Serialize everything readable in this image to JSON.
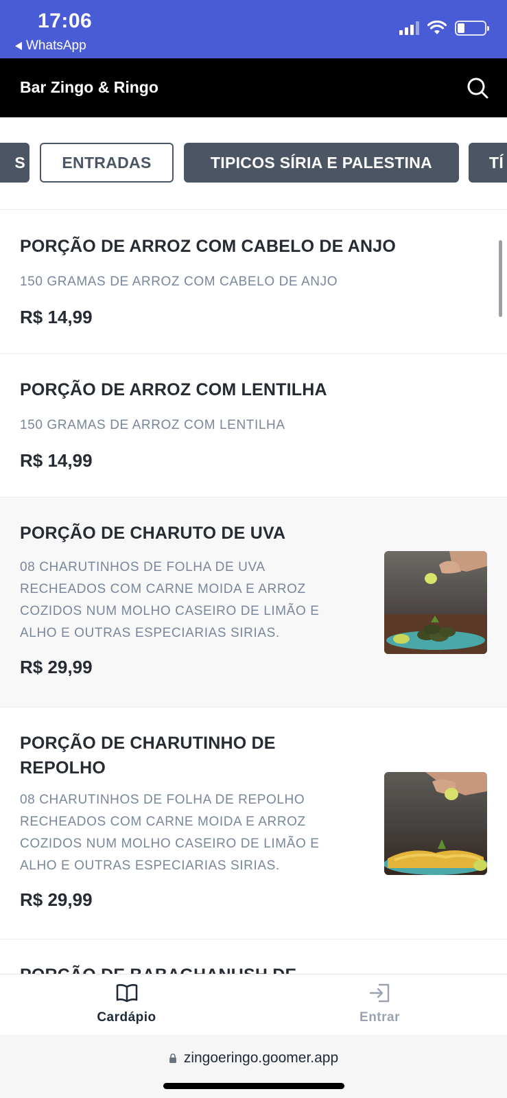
{
  "status_bar": {
    "time": "17:06",
    "back_app": "WhatsApp",
    "icons": [
      "signal-icon",
      "wifi-icon",
      "battery-icon"
    ],
    "battery_level": 0.2,
    "bg_color": "#4a5bd6"
  },
  "header": {
    "title": "Bar Zingo & Ringo",
    "search_icon": "search-icon"
  },
  "categories": {
    "items": [
      {
        "label": "S",
        "active": false
      },
      {
        "label": "ENTRADAS",
        "active": true
      },
      {
        "label": "TIPICOS SÍRIA E PALESTINA",
        "active": false
      },
      {
        "label": "TÍ",
        "active": false
      }
    ]
  },
  "menu": {
    "items": [
      {
        "title": "PORÇÃO DE ARROZ COM CABELO DE ANJO",
        "description": "150 GRAMAS DE ARROZ COM CABELO DE ANJO",
        "price": "R$ 14,99"
      },
      {
        "title": "PORÇÃO DE ARROZ COM LENTILHA",
        "description": "150 GRAMAS DE ARROZ COM LENTILHA",
        "price": "R$ 14,99"
      },
      {
        "title": "PORÇÃO DE CHARUTO DE UVA",
        "description_lines": [
          "08 CHARUTINHOS DE FOLHA DE UVA",
          "RECHEADOS COM CARNE MOIDA E ARROZ",
          "COZIDOS NUM MOLHO CASEIRO DE LIMÃO E",
          "ALHO E OUTRAS ESPECIARIAS SIRIAS."
        ],
        "price": "R$ 29,99"
      },
      {
        "title_lines": [
          "PORÇÃO DE CHARUTINHO DE",
          "REPOLHO"
        ],
        "description_lines": [
          "08 CHARUTINHOS DE FOLHA DE REPOLHO",
          "RECHEADOS COM CARNE MOIDA E ARROZ",
          "COZIDOS NUM MOLHO CASEIRO DE LIMÃO E",
          "ALHO E OUTRAS ESPECIARIAS SIRIAS."
        ],
        "price": "R$ 29,99"
      },
      {
        "title": "PORÇÃO DE BABAGHANUSH DE"
      }
    ]
  },
  "bottom_nav": {
    "items": [
      {
        "label": "Cardápio",
        "icon": "book-open-icon",
        "active": true
      },
      {
        "label": "Entrar",
        "icon": "login-icon",
        "active": false
      }
    ]
  },
  "browser": {
    "url": "zingoeringo.goomer.app"
  }
}
